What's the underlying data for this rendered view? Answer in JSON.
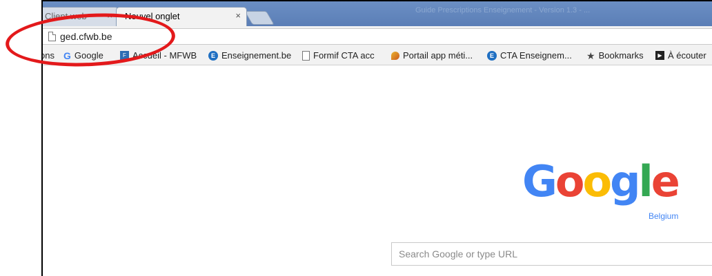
{
  "tabs": [
    {
      "label": "Client web",
      "close": "×",
      "active": false
    },
    {
      "label": "Nouvel onglet",
      "close": "×",
      "active": true
    }
  ],
  "titlebar_text": "Guide Prescriptions Enseignement - Version 1.3 - ...",
  "address_bar": {
    "url": "ged.cfwb.be",
    "icon": "page-icon"
  },
  "bookmarks": [
    {
      "label": "ons",
      "icon": "apps-icon"
    },
    {
      "label": "Google",
      "icon": "google-icon"
    },
    {
      "label": "Accueil - MFWB",
      "icon": "mfwb-icon"
    },
    {
      "label": "Enseignement.be",
      "icon": "enseignement-icon"
    },
    {
      "label": "Formif CTA acc",
      "icon": "page-icon"
    },
    {
      "label": "Portail app méti...",
      "icon": "portal-icon"
    },
    {
      "label": "CTA Enseignem...",
      "icon": "enseignement-icon"
    },
    {
      "label": "Bookmarks",
      "icon": "star-icon"
    },
    {
      "label": "À écouter",
      "icon": "audio-icon"
    }
  ],
  "google": {
    "letters": [
      {
        "ch": "G",
        "color": "#4285f4"
      },
      {
        "ch": "o",
        "color": "#ea4335"
      },
      {
        "ch": "o",
        "color": "#fbbc05"
      },
      {
        "ch": "g",
        "color": "#4285f4"
      },
      {
        "ch": "l",
        "color": "#34a853"
      },
      {
        "ch": "e",
        "color": "#ea4335"
      }
    ],
    "region": "Belgium",
    "search_placeholder": "Search Google or type URL"
  },
  "annotation_color": "#e3191b"
}
